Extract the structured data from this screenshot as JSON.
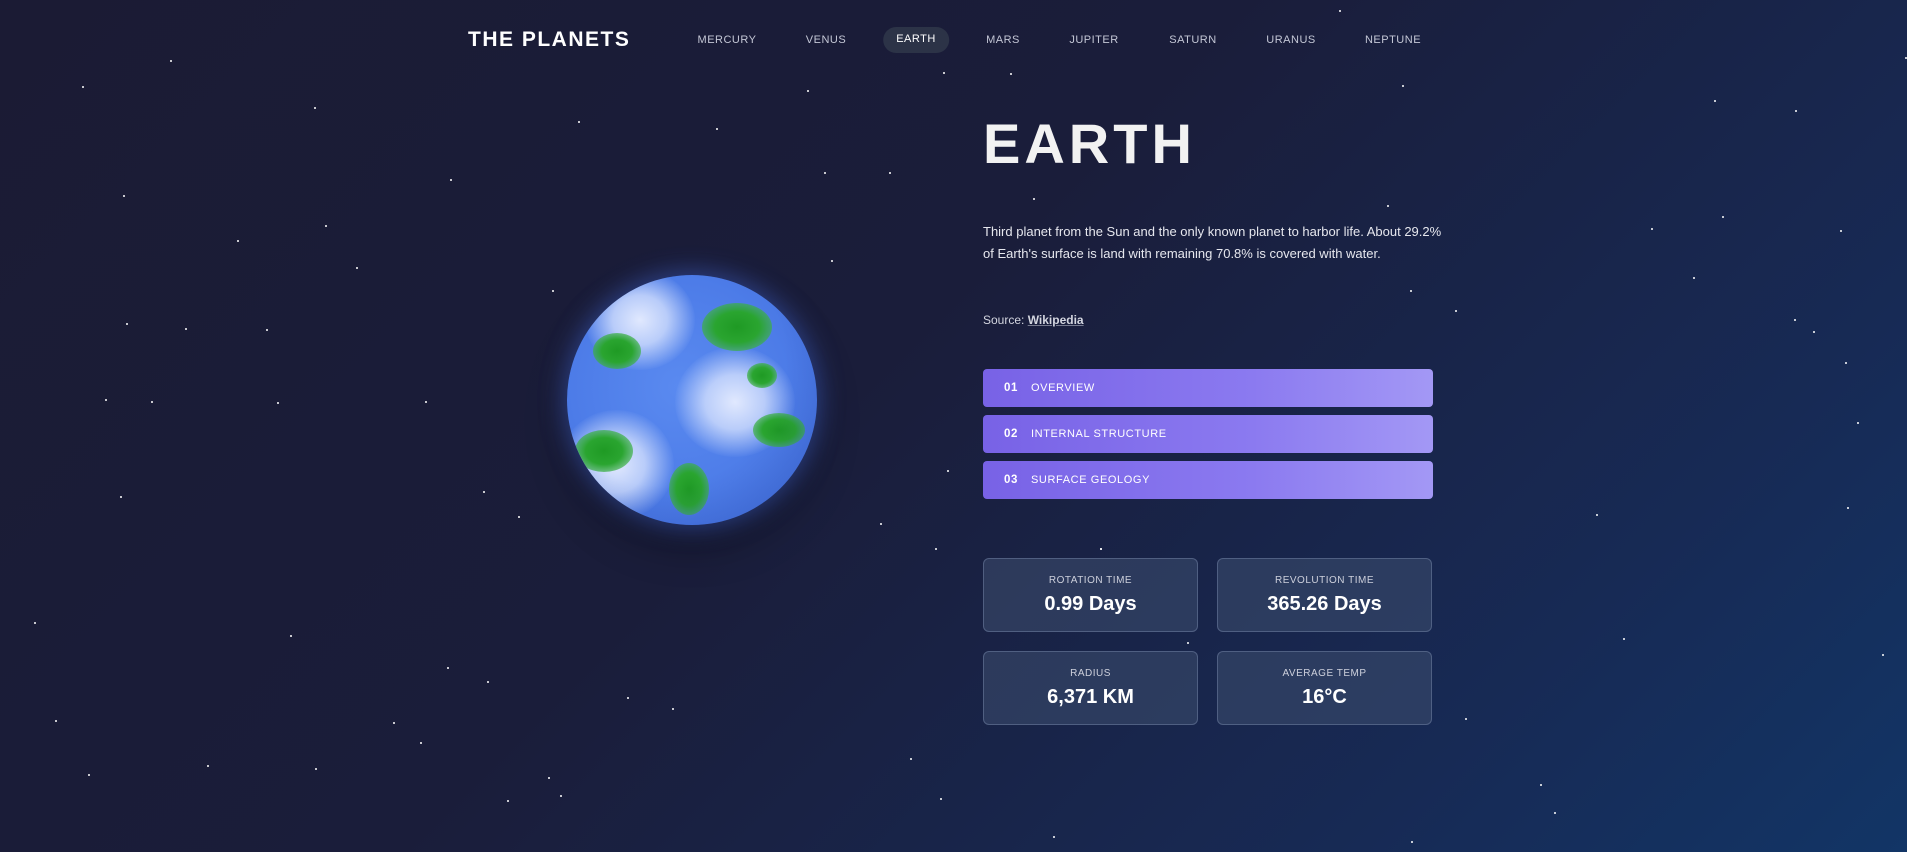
{
  "header": {
    "logo": "THE PLANETS",
    "nav": [
      {
        "label": "MERCURY",
        "active": false
      },
      {
        "label": "VENUS",
        "active": false
      },
      {
        "label": "EARTH",
        "active": true
      },
      {
        "label": "MARS",
        "active": false
      },
      {
        "label": "JUPITER",
        "active": false
      },
      {
        "label": "SATURN",
        "active": false
      },
      {
        "label": "URANUS",
        "active": false
      },
      {
        "label": "NEPTUNE",
        "active": false
      }
    ]
  },
  "planet": {
    "name": "EARTH",
    "description": "Third planet from the Sun and the only known planet to harbor life. About 29.2% of Earth's surface is land with remaining 70.8% is covered with water.",
    "source_prefix": "Source: ",
    "source_link": "Wikipedia"
  },
  "tabs": [
    {
      "number": "01",
      "label": "OVERVIEW"
    },
    {
      "number": "02",
      "label": "INTERNAL STRUCTURE"
    },
    {
      "number": "03",
      "label": "SURFACE GEOLOGY"
    }
  ],
  "stats": [
    {
      "label": "ROTATION TIME",
      "value": "0.99 Days"
    },
    {
      "label": "REVOLUTION TIME",
      "value": "365.26 Days"
    },
    {
      "label": "RADIUS",
      "value": "6,371 KM"
    },
    {
      "label": "AVERAGE TEMP",
      "value": "16°C"
    }
  ],
  "colors": {
    "accent": "#8b7af0",
    "ocean": "#4d7ce8",
    "land": "#2aa530",
    "background": "#1a1d3a"
  }
}
